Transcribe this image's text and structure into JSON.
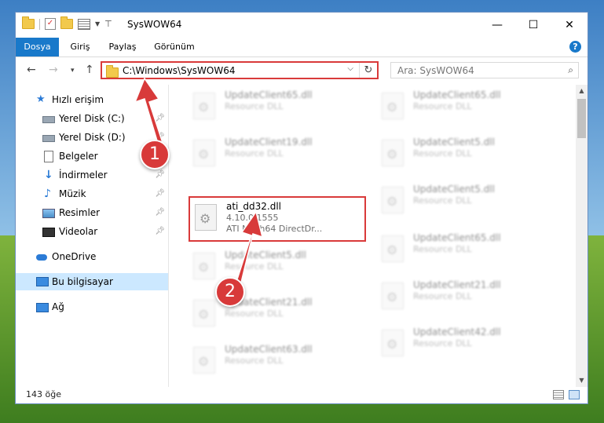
{
  "window": {
    "title": "SysWOW64"
  },
  "titlebar": {
    "minimize": "—",
    "maximize": "☐",
    "close": "✕"
  },
  "ribbon": {
    "tabs": [
      "Dosya",
      "Giriş",
      "Paylaş",
      "Görünüm"
    ],
    "help": "?"
  },
  "address": {
    "path": "C:\\Windows\\SysWOW64",
    "search_placeholder": "Ara: SysWOW64"
  },
  "navpane": {
    "items": [
      {
        "label": "Hızlı erişim",
        "icon": "star-icon"
      },
      {
        "label": "Yerel Disk (C:)",
        "icon": "disk-icon",
        "pinned": true
      },
      {
        "label": "Yerel Disk (D:)",
        "icon": "disk-icon",
        "pinned": true
      },
      {
        "label": "Belgeler",
        "icon": "document-icon",
        "pinned": true
      },
      {
        "label": "İndirmeler",
        "icon": "download-icon",
        "pinned": true
      },
      {
        "label": "Müzik",
        "icon": "music-icon",
        "pinned": true
      },
      {
        "label": "Resimler",
        "icon": "pictures-icon",
        "pinned": true
      },
      {
        "label": "Videolar",
        "icon": "videos-icon",
        "pinned": true
      },
      {
        "label": "OneDrive",
        "icon": "cloud-icon"
      },
      {
        "label": "Bu bilgisayar",
        "icon": "computer-icon",
        "selected": true
      },
      {
        "label": "Ağ",
        "icon": "network-icon"
      }
    ]
  },
  "files": {
    "highlighted": {
      "name": "ati_dd32.dll",
      "version": "4.10.0.1555",
      "description": "ATI Mach64 DirectDr..."
    },
    "left_column": [
      {
        "name": "UpdateClient65.dll",
        "type": "Resource DLL"
      },
      {
        "name": "UpdateClient19.dll",
        "type": "Resource DLL"
      },
      {
        "name": "UpdateClient5.dll",
        "type": "Resource DLL"
      },
      {
        "name": "UpdateClient21.dll",
        "type": "Resource DLL"
      },
      {
        "name": "UpdateClient63.dll",
        "type": "Resource DLL"
      }
    ],
    "right_column": [
      {
        "name": "UpdateClient65.dll",
        "type": "Resource DLL"
      },
      {
        "name": "UpdateClient5.dll",
        "type": "Resource DLL"
      },
      {
        "name": "UpdateClient5.dll",
        "type": "Resource DLL"
      },
      {
        "name": "UpdateClient65.dll",
        "type": "Resource DLL"
      },
      {
        "name": "UpdateClient21.dll",
        "type": "Resource DLL"
      },
      {
        "name": "UpdateClient42.dll",
        "type": "Resource DLL"
      }
    ]
  },
  "status": {
    "count": "143 öğe"
  },
  "annotations": {
    "badge1": "1",
    "badge2": "2",
    "accent": "#d83a3a"
  }
}
